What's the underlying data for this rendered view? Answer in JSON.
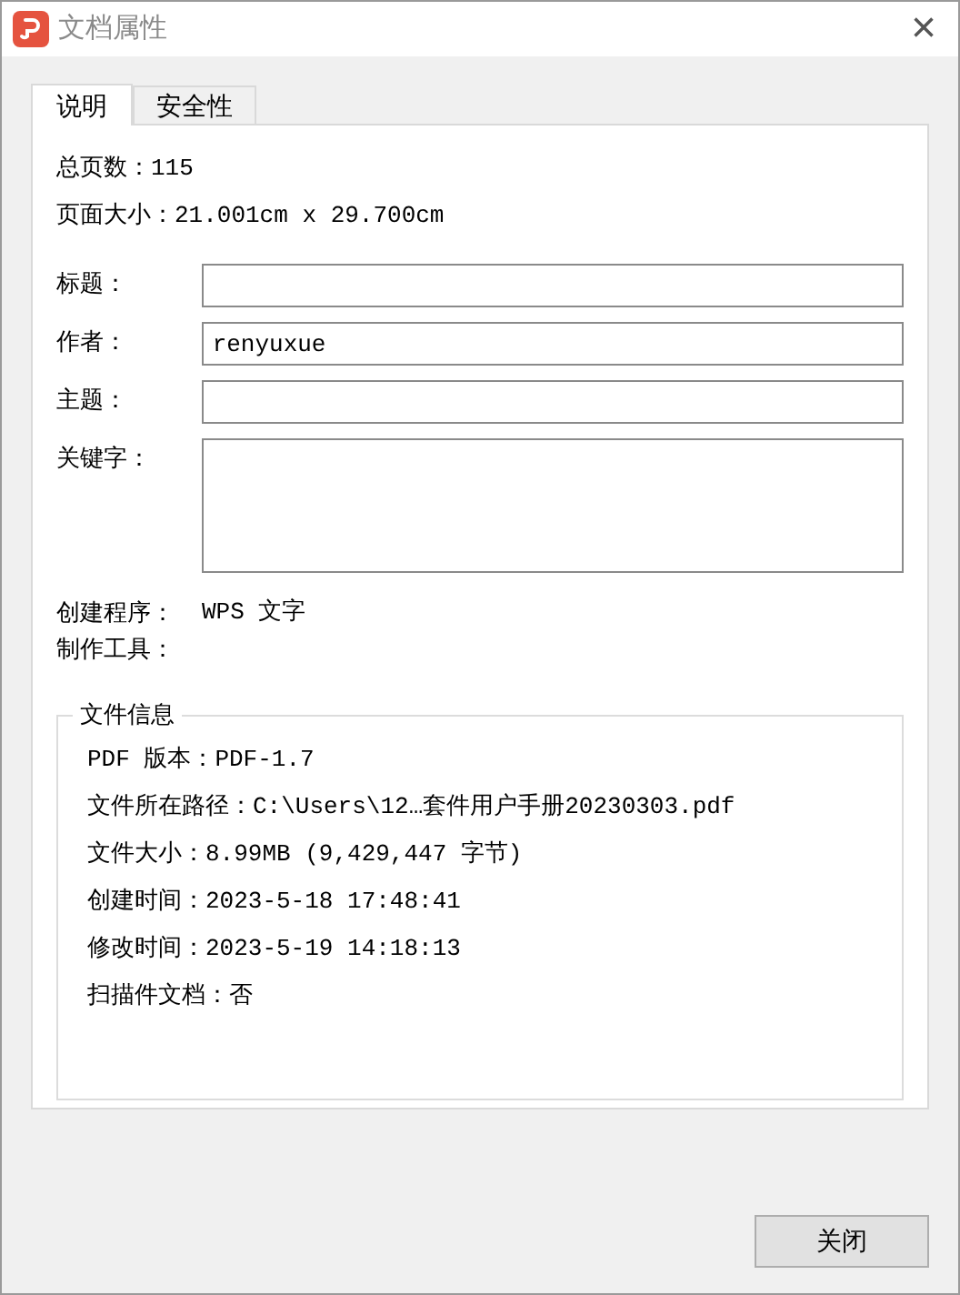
{
  "window": {
    "title": "文档属性",
    "close": "×"
  },
  "tabs": [
    {
      "label": "说明",
      "selected": true
    },
    {
      "label": "安全性",
      "selected": false
    }
  ],
  "summary": [
    "总页数：115",
    "页面大小：21.001cm x 29.700cm"
  ],
  "fields": [
    {
      "label": "标题：",
      "kind": "input"
    },
    {
      "label": "作者：",
      "kind": "input",
      "value": "renyuxue"
    },
    {
      "label": "主题：",
      "kind": "input"
    },
    {
      "label": "关键字：",
      "kind": "textarea"
    }
  ],
  "producer": [
    {
      "label": "创建程序：",
      "value": "WPS 文字"
    },
    {
      "label": "制作工具："
    }
  ],
  "file_info": {
    "legend": "文件信息",
    "lines": [
      "PDF 版本：PDF-1.7",
      "文件所在路径：C:\\Users\\12…套件用户手册20230303.pdf",
      "文件大小：8.99MB (9,429,447 字节)",
      "创建时间：2023-5-18 17:48:41",
      "修改时间：2023-5-19 14:18:13",
      "扫描件文档：否"
    ]
  },
  "buttons": [
    "关闭"
  ]
}
